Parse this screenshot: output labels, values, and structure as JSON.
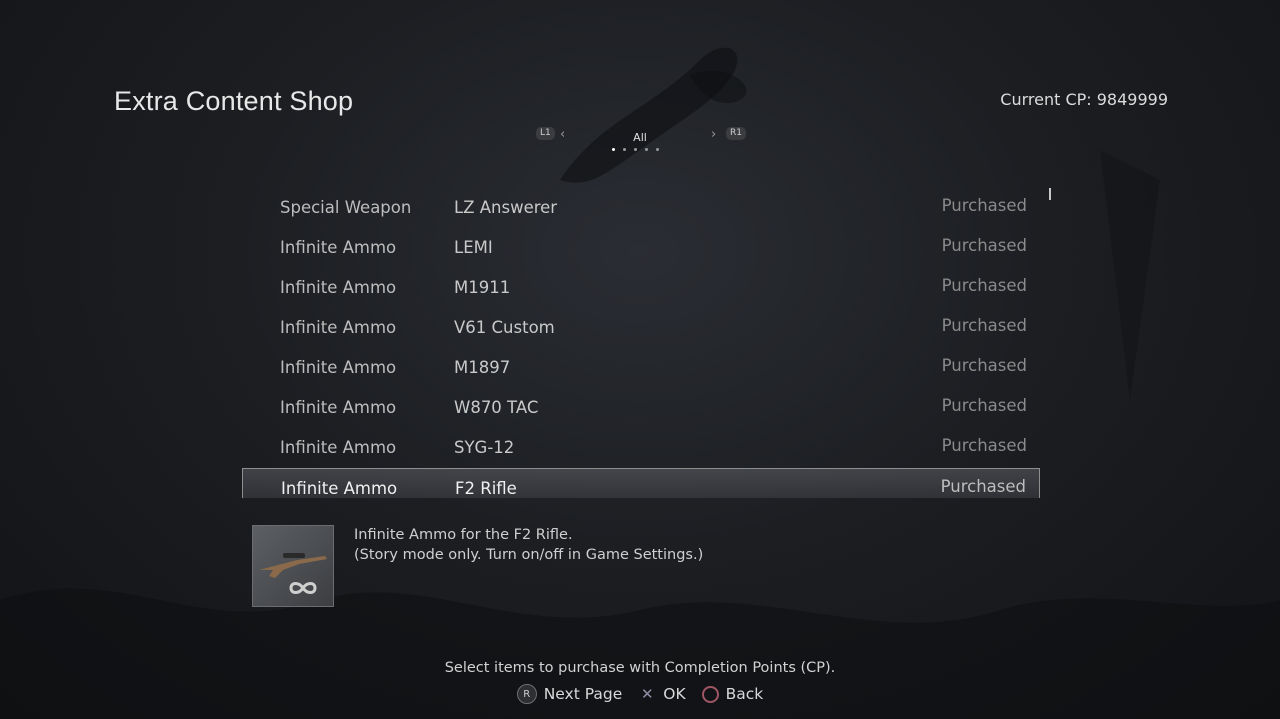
{
  "header": {
    "title": "Extra Content Shop",
    "cp_label": "Current CP: 9849999"
  },
  "tabs": {
    "left_button": "L1",
    "right_button": "R1",
    "prev_icon": "chevron-left-icon",
    "next_icon": "chevron-right-icon",
    "current_label": "All",
    "page_count": 5,
    "active_page": 1
  },
  "items": [
    {
      "category": "Special Weapon",
      "name": "LZ Answerer",
      "status": "Purchased"
    },
    {
      "category": "Infinite Ammo",
      "name": "LEMI",
      "status": "Purchased"
    },
    {
      "category": "Infinite Ammo",
      "name": "M1911",
      "status": "Purchased"
    },
    {
      "category": "Infinite Ammo",
      "name": "V61 Custom",
      "status": "Purchased"
    },
    {
      "category": "Infinite Ammo",
      "name": "M1897",
      "status": "Purchased"
    },
    {
      "category": "Infinite Ammo",
      "name": "W870 TAC",
      "status": "Purchased"
    },
    {
      "category": "Infinite Ammo",
      "name": "SYG-12",
      "status": "Purchased"
    },
    {
      "category": "Infinite Ammo",
      "name": "F2 Rifle",
      "status": "Purchased"
    }
  ],
  "selected_index": 7,
  "detail": {
    "thumbnail_icon": "rifle-infinity-icon",
    "line1": "Infinite Ammo for the F2 Rifle.",
    "line2": "(Story mode only. Turn on/off in Game Settings.)"
  },
  "footer": {
    "hint": "Select items to purchase with Completion Points (CP).",
    "next_page_button": "R",
    "next_page_label": "Next Page",
    "ok_label": "OK",
    "back_label": "Back"
  },
  "colors": {
    "ok_glyph": "#8d8ea6",
    "back_glyph": "#a05565"
  }
}
